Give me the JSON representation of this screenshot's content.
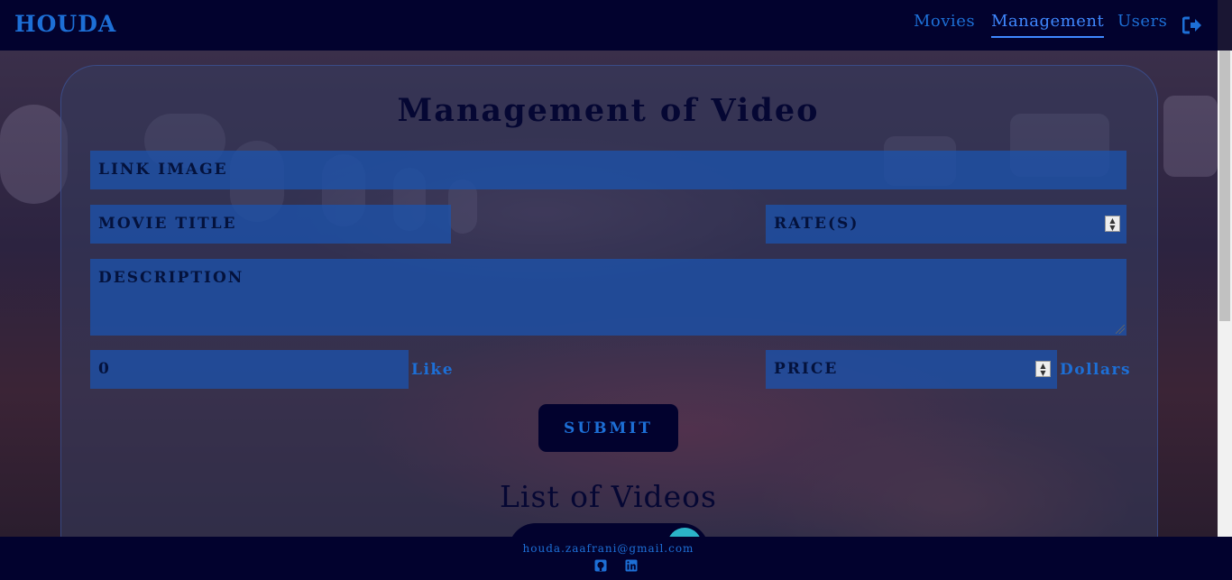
{
  "navbar": {
    "brand": "HOUDA",
    "links": [
      {
        "label": "Movies"
      },
      {
        "label": "Management",
        "active": true
      },
      {
        "label": "Users"
      }
    ],
    "logout_icon": "sign-out-icon"
  },
  "form": {
    "title": "Management of Video",
    "link_image_placeholder": "LINK IMAGE",
    "movie_title_placeholder": "MOVIE TITLE",
    "rate_placeholder": "RATE(S)",
    "description_placeholder": "DESCRIPTION",
    "likes_value": "0",
    "likes_unit": "Like",
    "price_placeholder": "PRICE",
    "price_unit": "Dollars",
    "submit_label": "SUBMIT"
  },
  "list": {
    "title": "List of Videos"
  },
  "footer": {
    "email": "houda.zaafrani@gmail.com",
    "icons": [
      "github-icon",
      "linkedin-icon"
    ]
  },
  "colors": {
    "navbar_bg": "#02022e",
    "accent": "#1d6fd6",
    "field_bg": "#1c52aa"
  }
}
